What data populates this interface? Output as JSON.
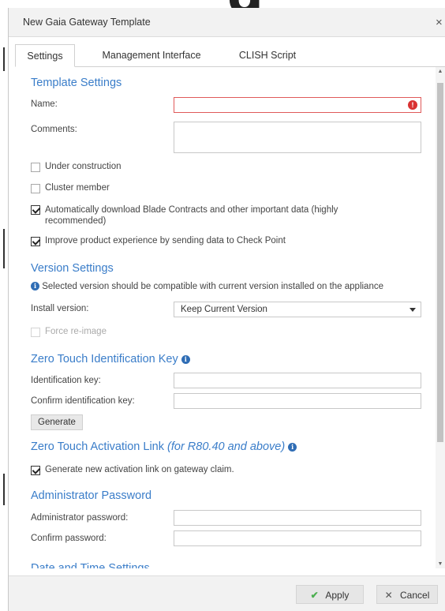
{
  "background": {
    "word": "g"
  },
  "dialog": {
    "title": "New Gaia Gateway Template",
    "close_glyph": "×"
  },
  "tabs": [
    {
      "label": "Settings",
      "active": true
    },
    {
      "label": "Management Interface",
      "active": false
    },
    {
      "label": "CLISH Script",
      "active": false
    }
  ],
  "template_settings": {
    "title": "Template Settings",
    "name_label": "Name:",
    "name_value": "",
    "comments_label": "Comments:",
    "comments_value": "",
    "error_glyph": "!"
  },
  "checkboxes": [
    {
      "label": "Under construction",
      "checked": false
    },
    {
      "label": "Cluster member",
      "checked": false
    },
    {
      "label": "Automatically download Blade Contracts and other important data (highly recommended)",
      "checked": true
    },
    {
      "label": "Improve product experience by sending data to Check Point",
      "checked": true
    }
  ],
  "version_settings": {
    "title": "Version Settings",
    "info_text": "Selected version should be compatible with current version installed on the appliance",
    "install_label": "Install version:",
    "install_value": "Keep Current Version",
    "force_reimage_label": "Force re-image",
    "force_reimage_checked": false,
    "force_reimage_disabled": true
  },
  "ztik": {
    "title": "Zero Touch Identification Key",
    "id_label": "Identification key:",
    "id_value": "",
    "confirm_label": "Confirm identification key:",
    "confirm_value": "",
    "generate_label": "Generate"
  },
  "ztal": {
    "title": "Zero Touch Activation Link",
    "title_note": "(for R80.40 and above)",
    "checkbox_label": "Generate new activation link on gateway claim.",
    "checkbox_checked": true
  },
  "admin_password": {
    "title": "Administrator Password",
    "password_label": "Administrator password:",
    "confirm_label": "Confirm password:"
  },
  "date_time": {
    "title": "Date and Time Settings"
  },
  "info_glyph": "i",
  "footer": {
    "apply_label": "Apply",
    "cancel_label": "Cancel",
    "apply_glyph": "✔",
    "cancel_glyph": "✕"
  },
  "colors": {
    "section_title": "#3a7dc9",
    "error": "#d93232",
    "info": "#2f6db5",
    "apply_check": "#4caf50"
  }
}
